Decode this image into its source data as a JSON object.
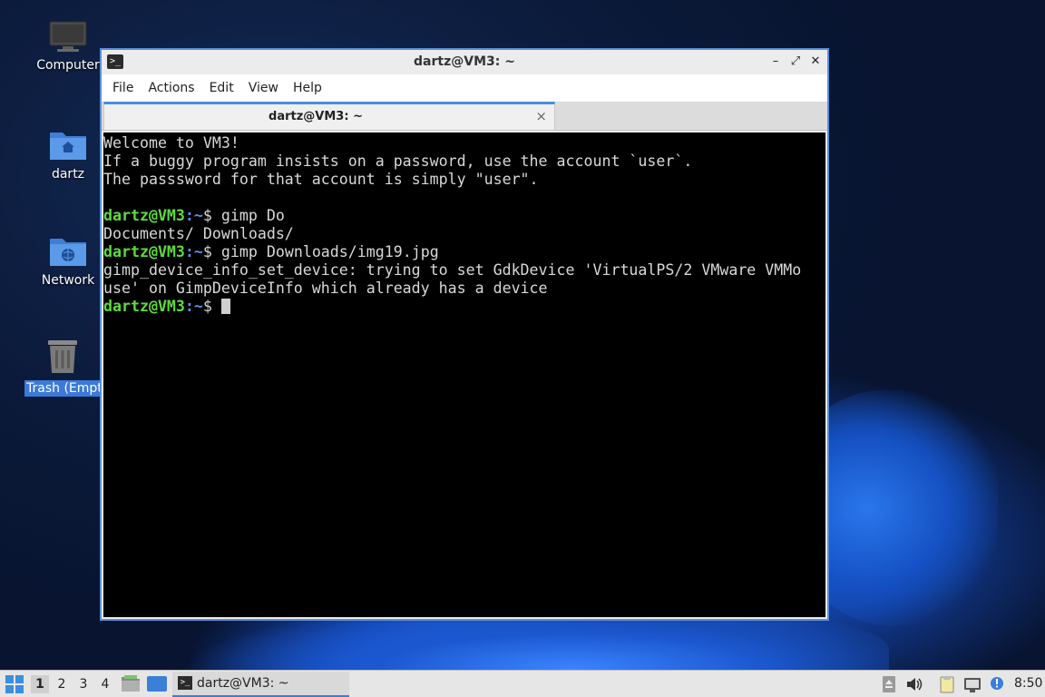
{
  "desktop": {
    "icons": [
      {
        "label": "Computer"
      },
      {
        "label": "dartz"
      },
      {
        "label": "Network"
      },
      {
        "label": "Trash (Empt"
      }
    ]
  },
  "window": {
    "title": "dartz@VM3: ~",
    "menu": [
      "File",
      "Actions",
      "Edit",
      "View",
      "Help"
    ],
    "tab": {
      "label": "dartz@VM3: ~",
      "close_glyph": "×"
    },
    "controls": {
      "minimize": "–",
      "maximize": "⤢",
      "close": "✕"
    }
  },
  "terminal": {
    "lines": [
      {
        "type": "text",
        "text": "Welcome to VM3!"
      },
      {
        "type": "text",
        "text": "If a buggy program insists on a password, use the account `user`."
      },
      {
        "type": "text",
        "text": "The passsword for that account is simply \"user\"."
      },
      {
        "type": "text",
        "text": ""
      },
      {
        "type": "prompt",
        "user": "dartz@VM3",
        "path": "~",
        "symbol": "$",
        "command": " gimp Do"
      },
      {
        "type": "text",
        "text": "Documents/ Downloads/"
      },
      {
        "type": "prompt",
        "user": "dartz@VM3",
        "path": "~",
        "symbol": "$",
        "command": " gimp Downloads/img19.jpg"
      },
      {
        "type": "text",
        "text": "gimp_device_info_set_device: trying to set GdkDevice 'VirtualPS/2 VMware VMMo"
      },
      {
        "type": "text",
        "text": "use' on GimpDeviceInfo which already has a device"
      },
      {
        "type": "prompt",
        "user": "dartz@VM3",
        "path": "~",
        "symbol": "$",
        "command": " ",
        "cursor": true
      }
    ]
  },
  "taskbar": {
    "workspaces": [
      "1",
      "2",
      "3",
      "4"
    ],
    "active_workspace": "1",
    "task_label": "dartz@VM3: ~",
    "clock": "8:50"
  },
  "colors": {
    "prompt_user": "#5ddc3b",
    "prompt_path": "#5c8ee8",
    "accent": "#3a7fd8"
  }
}
